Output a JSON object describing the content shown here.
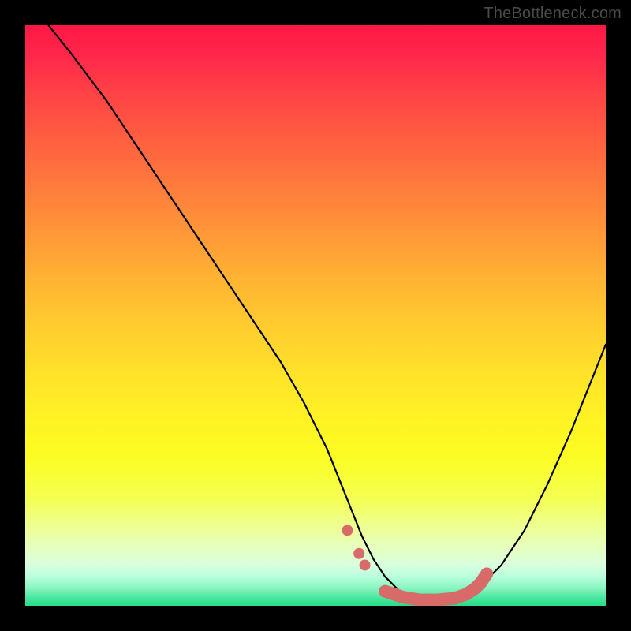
{
  "watermark": "TheBottleneck.com",
  "chart_data": {
    "type": "line",
    "title": "",
    "xlabel": "",
    "ylabel": "",
    "xlim": [
      0,
      100
    ],
    "ylim": [
      0,
      100
    ],
    "series": [
      {
        "name": "bottleneck-curve",
        "x": [
          4,
          8,
          14,
          20,
          26,
          32,
          38,
          44,
          48,
          52,
          54,
          56,
          58,
          60,
          62,
          65,
          68,
          70,
          72,
          75,
          78,
          82,
          86,
          90,
          94,
          98,
          100
        ],
        "y": [
          100,
          95,
          87,
          78,
          69,
          60,
          51,
          42,
          35,
          27,
          22,
          17,
          12,
          8,
          5,
          2,
          1,
          0.5,
          0.5,
          1,
          3,
          7,
          13,
          21,
          30,
          40,
          45
        ]
      }
    ],
    "markers": {
      "name": "highlight-points",
      "color": "#d86a6a",
      "points": [
        {
          "x": 55.5,
          "y": 13
        },
        {
          "x": 57.5,
          "y": 9
        },
        {
          "x": 58.5,
          "y": 7
        },
        {
          "x": 62,
          "y": 2.5
        },
        {
          "x": 65,
          "y": 1.5
        },
        {
          "x": 68,
          "y": 1
        },
        {
          "x": 71,
          "y": 1
        },
        {
          "x": 74,
          "y": 1.3
        },
        {
          "x": 76,
          "y": 2
        },
        {
          "x": 77.5,
          "y": 3
        },
        {
          "x": 78.5,
          "y": 4
        },
        {
          "x": 79.5,
          "y": 5.5
        }
      ]
    },
    "gradient_stops": [
      {
        "pos": 0,
        "color": "#ff1746"
      },
      {
        "pos": 50,
        "color": "#ffcd2e"
      },
      {
        "pos": 75,
        "color": "#fcfc22"
      },
      {
        "pos": 100,
        "color": "#28dd88"
      }
    ]
  }
}
